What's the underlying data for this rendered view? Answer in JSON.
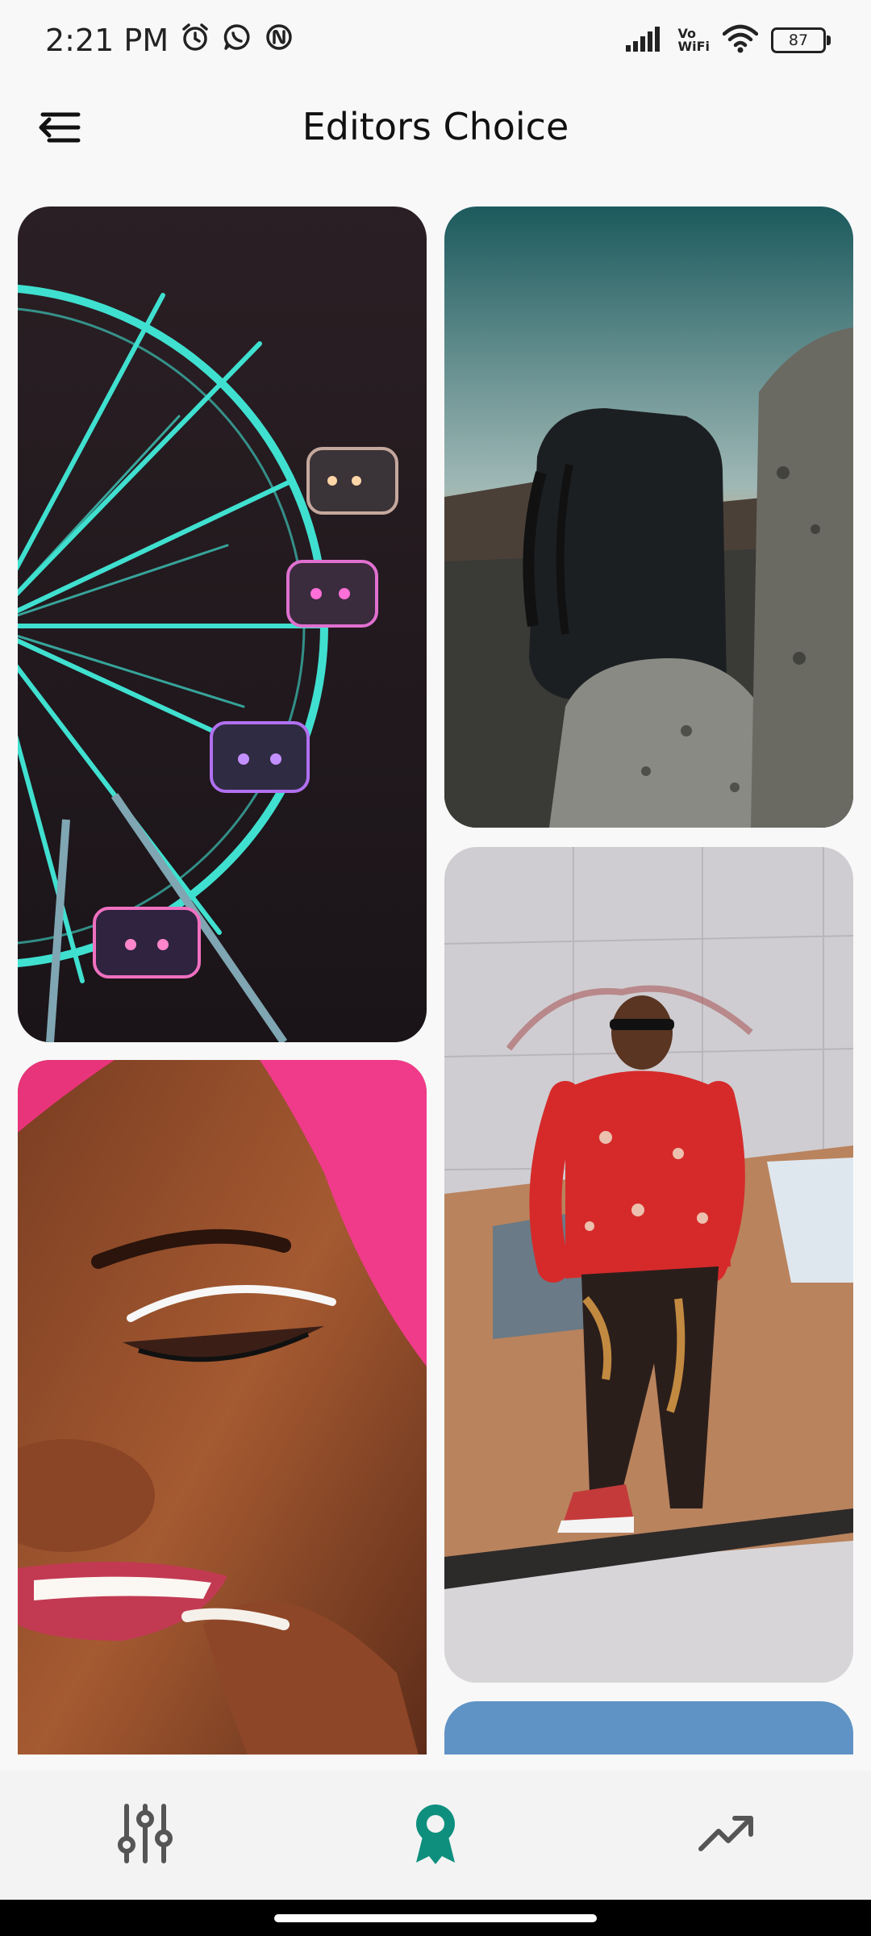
{
  "status_bar": {
    "time": "2:21 PM",
    "icons": [
      "alarm-icon",
      "whatsapp-icon",
      "app-notification-icon"
    ],
    "network": [
      "signal-icon",
      "vowifi-icon",
      "wifi-icon"
    ],
    "vowifi_top": "Vo",
    "vowifi_bottom": "WiFi",
    "battery": "87"
  },
  "app_bar": {
    "title": "Editors Choice",
    "menu_icon": "menu-back-icon"
  },
  "feed": {
    "photos": [
      {
        "subject": "ferris-wheel-night",
        "column": "left"
      },
      {
        "subject": "backpack-sunset-rocks",
        "column": "right"
      },
      {
        "subject": "man-red-jacket-car",
        "column": "right"
      },
      {
        "subject": "woman-pink-hair-makeup",
        "column": "left"
      },
      {
        "subject": "sky-partial",
        "column": "right"
      }
    ]
  },
  "bottom_nav": {
    "items": [
      {
        "icon": "sliders-icon",
        "selected": false
      },
      {
        "icon": "award-ribbon-icon",
        "selected": true
      },
      {
        "icon": "trending-up-icon",
        "selected": false
      }
    ],
    "accent_color": "#0e8f7e",
    "inactive_color": "#555555"
  }
}
